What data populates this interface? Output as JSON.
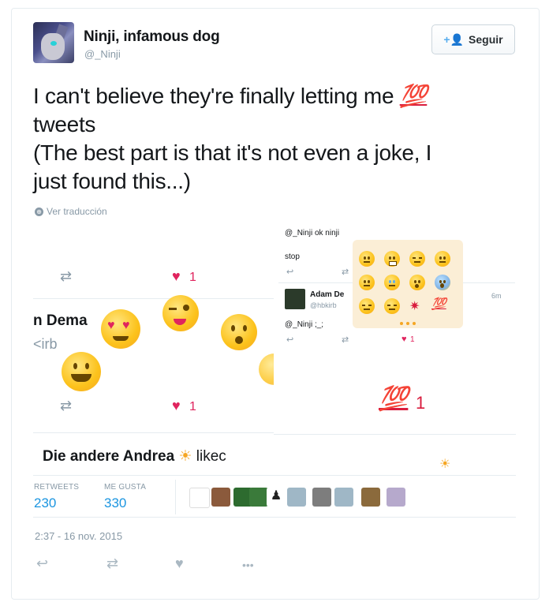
{
  "author": {
    "name": "Ninji, infamous dog",
    "handle": "@_Ninji"
  },
  "follow_label": "Seguir",
  "tweet_lines": [
    "I can't believe they're finally letting me ",
    "tweets",
    "(The best part is that it's not even a joke, I",
    "just found this...)"
  ],
  "hundred_emoji": "💯",
  "translate_label": "Ver traducción",
  "media": {
    "left": {
      "like_count_top": "1",
      "name_fragment": "n Dema",
      "handle_fragment": "<irb",
      "like_count_bottom": "1",
      "liked_prefix": "Die andere Andrea",
      "liked_suffix": "likec"
    },
    "right": {
      "reply_to": "@_Ninji ok ninji",
      "reply_text": "stop",
      "user_name": "Adam De",
      "user_handle": "@hbkirb",
      "time": "6m",
      "reply_body": "@_Ninji ;_;",
      "like_count": "1",
      "hundred_count": "1"
    }
  },
  "stats": {
    "retweets_label": "RETWEETS",
    "retweets_value": "230",
    "likes_label": "ME GUSTA",
    "likes_value": "330"
  },
  "timestamp": "2:37 - 16 nov. 2015",
  "icons": [
    "reply-icon",
    "retweet-icon",
    "heart-icon",
    "more-icon"
  ],
  "colors": {
    "like": "#e0245e",
    "link": "#1b95e0",
    "muted": "#8899a6",
    "hundred": "#d91d3e"
  }
}
